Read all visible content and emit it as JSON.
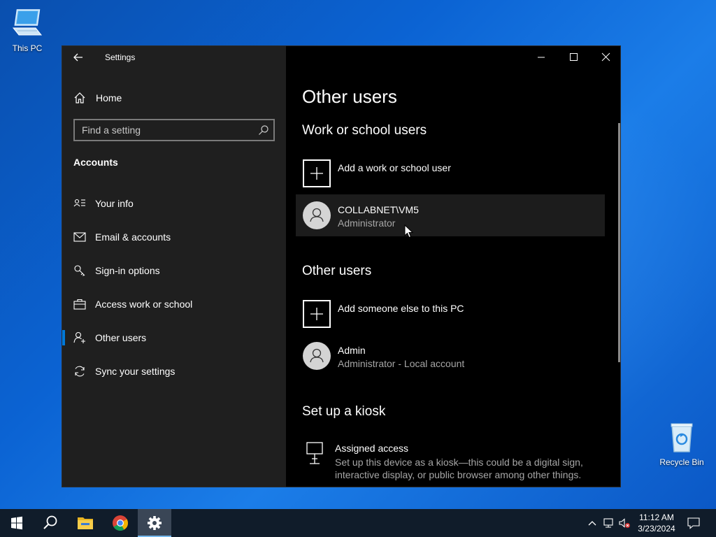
{
  "desktop": {
    "icons": [
      {
        "label": "This PC"
      },
      {
        "label": "Recycle Bin"
      }
    ]
  },
  "window": {
    "title": "Settings",
    "controls": [
      "minimize-icon",
      "maximize-icon",
      "close-icon"
    ]
  },
  "sidebar": {
    "home_label": "Home",
    "search_placeholder": "Find a setting",
    "section_title": "Accounts",
    "items": [
      {
        "label": "Your info",
        "icon": "person-card-icon"
      },
      {
        "label": "Email & accounts",
        "icon": "mail-icon"
      },
      {
        "label": "Sign-in options",
        "icon": "key-icon"
      },
      {
        "label": "Access work or school",
        "icon": "briefcase-icon"
      },
      {
        "label": "Other users",
        "icon": "person-add-icon",
        "active": true
      },
      {
        "label": "Sync your settings",
        "icon": "sync-icon"
      }
    ]
  },
  "main": {
    "page_title": "Other users",
    "work_section": {
      "heading": "Work or school users",
      "add_label": "Add a work or school user",
      "users": [
        {
          "name": "COLLABNET\\VM5",
          "role": "Administrator"
        }
      ]
    },
    "other_section": {
      "heading": "Other users",
      "add_label": "Add someone else to this PC",
      "users": [
        {
          "name": "Admin",
          "role": "Administrator - Local account"
        }
      ]
    },
    "kiosk_section": {
      "heading": "Set up a kiosk",
      "title": "Assigned access",
      "description": "Set up this device as a kiosk—this could be a digital sign, interactive display, or public browser among other things."
    }
  },
  "taskbar": {
    "apps": [
      "start-icon",
      "search-icon",
      "file-explorer-icon",
      "chrome-icon",
      "settings-gear-icon"
    ],
    "time": "11:12 AM",
    "date": "3/23/2024"
  },
  "colors": {
    "accent": "#0078d7",
    "sidebar_bg": "#1f1f1f",
    "content_bg": "#000000",
    "taskbar_bg": "#101c2a"
  }
}
